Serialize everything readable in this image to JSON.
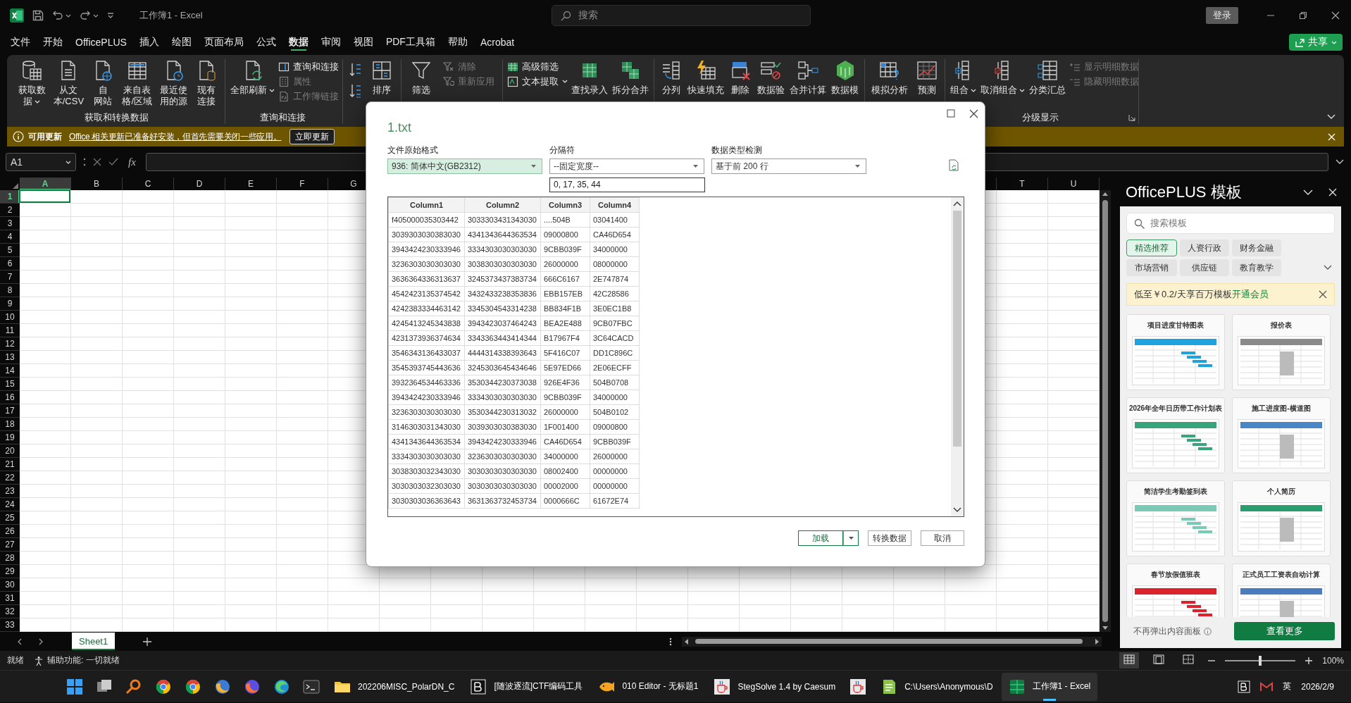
{
  "title_bar": {
    "title": "工作簿1  -  Excel",
    "search_placeholder": "搜索",
    "sign_in": "登录"
  },
  "menu": {
    "items": [
      {
        "label": "文件",
        "selected": false
      },
      {
        "label": "开始",
        "selected": false
      },
      {
        "label": "OfficePLUS",
        "selected": false
      },
      {
        "label": "插入",
        "selected": false
      },
      {
        "label": "绘图",
        "selected": false
      },
      {
        "label": "页面布局",
        "selected": false
      },
      {
        "label": "公式",
        "selected": false
      },
      {
        "label": "数据",
        "selected": true
      },
      {
        "label": "审阅",
        "selected": false
      },
      {
        "label": "视图",
        "selected": false
      },
      {
        "label": "PDF工具箱",
        "selected": false
      },
      {
        "label": "帮助",
        "selected": false
      },
      {
        "label": "Acrobat",
        "selected": false
      }
    ],
    "share": "共享"
  },
  "ribbon": {
    "groups": [
      {
        "label": "获取和转换数据",
        "items": [
          {
            "kind": "large",
            "lines": [
              "获取数",
              "据"
            ],
            "dropdown": true
          },
          {
            "kind": "large",
            "lines": [
              "从文",
              "本/CSV"
            ],
            "dropdown": false
          },
          {
            "kind": "large",
            "lines": [
              "自",
              "网站"
            ],
            "dropdown": false
          },
          {
            "kind": "large",
            "lines": [
              "来自表",
              "格/区域"
            ],
            "dropdown": false
          },
          {
            "kind": "large",
            "lines": [
              "最近使",
              "用的源"
            ],
            "dropdown": false
          },
          {
            "kind": "large",
            "lines": [
              "现有",
              "连接"
            ],
            "dropdown": false
          }
        ]
      },
      {
        "label": "查询和连接",
        "items": [
          {
            "kind": "large",
            "lines": [
              "全部刷新"
            ],
            "dropdown": true
          },
          {
            "kind": "stack",
            "items": [
              {
                "label": "查询和连接",
                "disabled": false,
                "dropdown": false
              },
              {
                "label": "属性",
                "disabled": true,
                "dropdown": false
              },
              {
                "label": "工作簿链接",
                "disabled": true,
                "dropdown": false
              }
            ]
          }
        ]
      },
      {
        "items": [
          {
            "kind": "sort_pair"
          },
          {
            "kind": "large",
            "lines": [
              "排序"
            ],
            "dropdown": false
          }
        ]
      },
      {
        "items": [
          {
            "kind": "large",
            "lines": [
              "筛选"
            ],
            "dropdown": false
          },
          {
            "kind": "stack",
            "items": [
              {
                "label": "清除",
                "disabled": true,
                "dropdown": false
              },
              {
                "label": "重新应用",
                "disabled": true,
                "dropdown": false
              }
            ]
          }
        ]
      },
      {
        "items": [
          {
            "kind": "stack",
            "items": [
              {
                "label": "高级筛选",
                "disabled": false,
                "dropdown": false
              },
              {
                "label": "文本提取",
                "disabled": false,
                "dropdown": true
              }
            ]
          },
          {
            "kind": "large",
            "lines": [
              "查找录入"
            ],
            "dropdown": false
          },
          {
            "kind": "large",
            "lines": [
              "拆分合并"
            ],
            "dropdown": false
          }
        ]
      },
      {
        "items": [
          {
            "kind": "large",
            "lines": [
              "分列"
            ],
            "dropdown": false
          },
          {
            "kind": "large",
            "lines": [
              "快速填充"
            ],
            "dropdown": false
          },
          {
            "kind": "large",
            "lines": [
              "删除"
            ],
            "dropdown": false
          },
          {
            "kind": "large",
            "lines": [
              "数据验"
            ],
            "dropdown": false
          },
          {
            "kind": "large",
            "lines": [
              "合并计算"
            ],
            "dropdown": false
          },
          {
            "kind": "large",
            "lines": [
              "数据模"
            ],
            "dropdown": false
          }
        ]
      },
      {
        "items": [
          {
            "kind": "large",
            "lines": [
              "模拟分析"
            ],
            "dropdown": false
          },
          {
            "kind": "large",
            "lines": [
              "预测"
            ],
            "dropdown": false
          }
        ]
      },
      {
        "label": "分级显示",
        "launcher": true,
        "items": [
          {
            "kind": "large",
            "lines": [
              "组合"
            ],
            "dropdown": true
          },
          {
            "kind": "large",
            "lines": [
              "取消组合"
            ],
            "dropdown": true
          },
          {
            "kind": "large",
            "lines": [
              "分类汇总"
            ],
            "dropdown": false
          },
          {
            "kind": "stack",
            "items": [
              {
                "label": "显示明细数据",
                "disabled": true,
                "dropdown": false
              },
              {
                "label": "隐藏明细数据",
                "disabled": true,
                "dropdown": false
              }
            ]
          }
        ]
      }
    ]
  },
  "update_bar": {
    "title": "可用更新",
    "message": "Office 相关更新已准备好安装，但首先需要关闭一些应用。",
    "button": "立即更新"
  },
  "formula_bar": {
    "name_box": "A1",
    "function_label": "fx"
  },
  "sheet": {
    "columns_left": [
      {
        "label": "A",
        "selected": true
      },
      {
        "label": "B",
        "selected": false
      },
      {
        "label": "C",
        "selected": false
      },
      {
        "label": "D",
        "selected": false
      },
      {
        "label": "E",
        "selected": false
      },
      {
        "label": "F",
        "selected": false
      },
      {
        "label": "G",
        "selected": false
      }
    ],
    "columns_right": [
      {
        "label": "T",
        "selected": false
      },
      {
        "label": "U",
        "selected": false
      }
    ],
    "rows": [
      {
        "label": "1",
        "selected": true
      },
      {
        "label": "2",
        "selected": false
      },
      {
        "label": "3",
        "selected": false
      },
      {
        "label": "4",
        "selected": false
      },
      {
        "label": "5",
        "selected": false
      },
      {
        "label": "6",
        "selected": false
      },
      {
        "label": "7",
        "selected": false
      },
      {
        "label": "8",
        "selected": false
      },
      {
        "label": "9",
        "selected": false
      },
      {
        "label": "10",
        "selected": false
      },
      {
        "label": "11",
        "selected": false
      },
      {
        "label": "12",
        "selected": false
      },
      {
        "label": "13",
        "selected": false
      },
      {
        "label": "14",
        "selected": false
      },
      {
        "label": "15",
        "selected": false
      },
      {
        "label": "16",
        "selected": false
      },
      {
        "label": "17",
        "selected": false
      },
      {
        "label": "18",
        "selected": false
      },
      {
        "label": "19",
        "selected": false
      },
      {
        "label": "20",
        "selected": false
      },
      {
        "label": "21",
        "selected": false
      },
      {
        "label": "22",
        "selected": false
      },
      {
        "label": "23",
        "selected": false
      },
      {
        "label": "24",
        "selected": false
      },
      {
        "label": "25",
        "selected": false
      },
      {
        "label": "26",
        "selected": false
      },
      {
        "label": "27",
        "selected": false
      },
      {
        "label": "28",
        "selected": false
      },
      {
        "label": "29",
        "selected": false
      },
      {
        "label": "30",
        "selected": false
      },
      {
        "label": "31",
        "selected": false
      },
      {
        "label": "32",
        "selected": false
      },
      {
        "label": "33",
        "selected": false
      }
    ],
    "tabs": [
      {
        "label": "Sheet1",
        "selected": true
      }
    ]
  },
  "dialog": {
    "title": "1.txt",
    "fields": [
      {
        "label": "文件原始格式",
        "value": "936: 简体中文(GB2312)",
        "selected": true
      },
      {
        "label": "分隔符",
        "value": "--固定宽度--",
        "selected": false
      },
      {
        "label": "数据类型检测",
        "value": "基于前 200 行",
        "selected": false
      }
    ],
    "widths": "0, 17, 35, 44",
    "preview": {
      "columns": [
        "Column1",
        "Column2",
        "Column3",
        "Column4"
      ],
      "rows": [
        [
          "f405000035303442",
          "3033303431343030",
          "....504B",
          "03041400"
        ],
        [
          "3039303030383030",
          "4341343644363534",
          "09000800",
          "CA46D654"
        ],
        [
          "3943424230333946",
          "3334303030303030",
          "9CBB039F",
          "34000000"
        ],
        [
          "3236303030303030",
          "3038303030303030",
          "26000000",
          "08000000"
        ],
        [
          "3636364336313637",
          "3245373437383734",
          "666C6167",
          "2E747874"
        ],
        [
          "4542423135374542",
          "3432433238353836",
          "EBB157EB",
          "42C28586"
        ],
        [
          "4242383334463142",
          "3345304543314238",
          "BB834F1B",
          "3E0EC1B8"
        ],
        [
          "4245413245343838",
          "3943423037464243",
          "BEA2E488",
          "9CB07FBC"
        ],
        [
          "4231373936374634",
          "3343363443414344",
          "B17967F4",
          "3C64CACD"
        ],
        [
          "3546343136433037",
          "4444314338393643",
          "5F416C07",
          "DD1C896C"
        ],
        [
          "3545393745443636",
          "3245303645434646",
          "5E97ED66",
          "2E06ECFF"
        ],
        [
          "3932364534463336",
          "3530344230373038",
          "926E4F36",
          "504B0708"
        ],
        [
          "3943424230333946",
          "3334303030303030",
          "9CBB039F",
          "34000000"
        ],
        [
          "3236303030303030",
          "3530344230313032",
          "26000000",
          "504B0102"
        ],
        [
          "3146303031343030",
          "3039303030383030",
          "1F001400",
          "09000800"
        ],
        [
          "4341343644363534",
          "3943424230333946",
          "CA46D654",
          "9CBB039F"
        ],
        [
          "3334303030303030",
          "3236303030303030",
          "34000000",
          "26000000"
        ],
        [
          "3038303032343030",
          "3030303030303030",
          "08002400",
          "00000000"
        ],
        [
          "3030303032303030",
          "3030303030303030",
          "00002000",
          "00000000"
        ],
        [
          "3030303036363643",
          "3631363732453734",
          "0000666C",
          "61672E74"
        ]
      ]
    },
    "buttons": [
      {
        "label": "加载",
        "kind": "split"
      },
      {
        "label": "转换数据",
        "kind": "plain"
      },
      {
        "label": "取消",
        "kind": "plain"
      }
    ]
  },
  "template_panel": {
    "title": "OfficePLUS 模板",
    "search_placeholder": "搜索模板",
    "categories": [
      {
        "label": "精选推荐",
        "selected": true
      },
      {
        "label": "人资行政",
        "selected": false
      },
      {
        "label": "财务金融",
        "selected": false
      },
      {
        "label": "市场营销",
        "selected": false
      },
      {
        "label": "供应链",
        "selected": false
      },
      {
        "label": "教育教学",
        "selected": false
      }
    ],
    "promo": {
      "text": "低至￥0.2/天享百万模板",
      "link": "开通会员"
    },
    "templates": [
      {
        "title": "项目进度甘特图表"
      },
      {
        "title": "报价表"
      },
      {
        "title": "2026年全年日历带工作计划表"
      },
      {
        "title": "施工进度图-横道图"
      },
      {
        "title": "简洁学生考勤签到表"
      },
      {
        "title": "个人简历"
      },
      {
        "title": "春节放假值班表"
      },
      {
        "title": "正式员工工资表自动计算"
      }
    ],
    "footer": "不再弹出内容面板",
    "more": "查看更多"
  },
  "status_bar": {
    "status": "就绪",
    "accessibility": "辅助功能: 一切就绪",
    "views": [
      {
        "selected": true
      },
      {
        "selected": false
      },
      {
        "selected": false
      }
    ],
    "zoom": {
      "level": 0.5,
      "reading": "100%"
    }
  },
  "taskbar": {
    "apps": [
      {
        "active": false
      },
      {
        "active": false
      },
      {
        "active": false
      },
      {
        "active": false
      },
      {
        "active": false
      },
      {
        "active": false
      },
      {
        "active": false
      },
      {
        "active": false
      },
      {
        "active": false
      },
      {
        "label": "202206MISC_PolarDN_C",
        "active": false
      },
      {
        "label": "[随波逐流]CTF编码工具",
        "active": false
      },
      {
        "label": "010 Editor - 无标题1",
        "active": false
      },
      {
        "label": "StegSolve 1.4 by Caesum",
        "active": false
      },
      {
        "active": false
      },
      {
        "label": "C:\\Users\\Anonymous\\D",
        "active": false
      },
      {
        "label": "工作簿1 - Excel",
        "active": true
      }
    ],
    "ime": "英",
    "date": "2026/2/9"
  }
}
